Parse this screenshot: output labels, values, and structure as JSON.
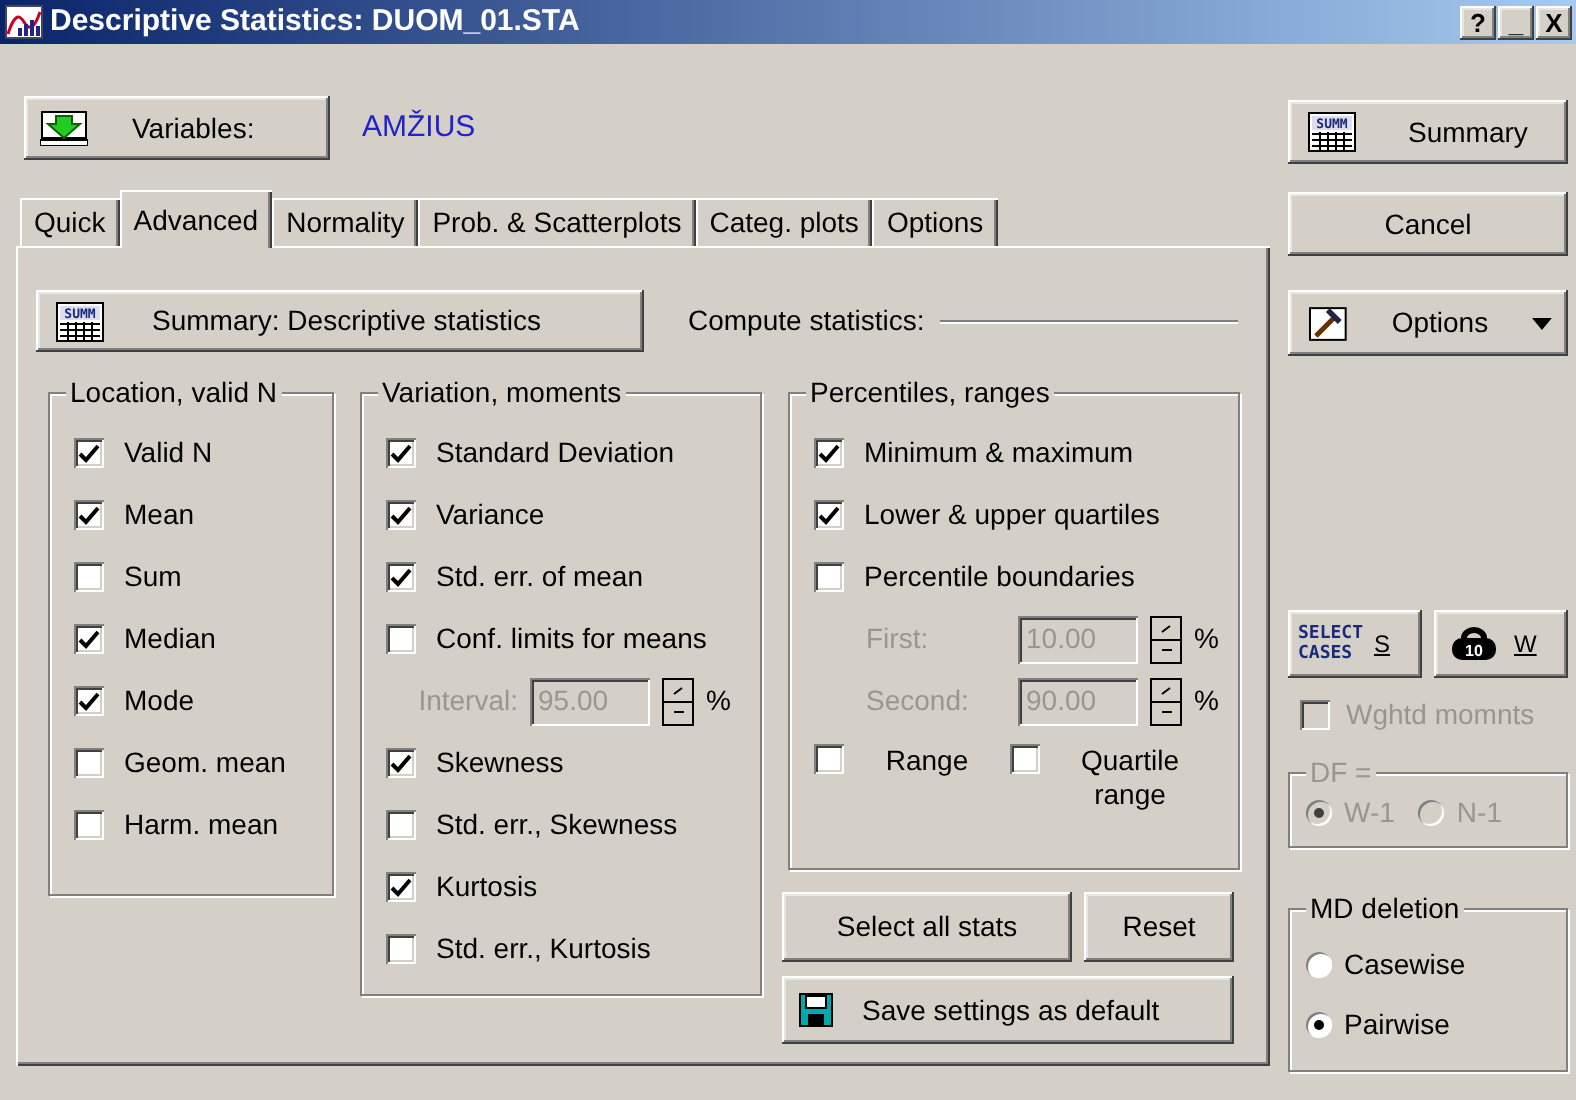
{
  "window": {
    "title": "Descriptive Statistics: DUOM_01.STA",
    "controls": [
      "?",
      "_",
      "X"
    ]
  },
  "variables": {
    "button": "Variables:",
    "value": "AMŽIUS"
  },
  "tabs": [
    {
      "label": "Quick",
      "selected": false
    },
    {
      "label": "Advanced",
      "selected": true
    },
    {
      "label": "Normality",
      "selected": false
    },
    {
      "label": "Prob. & Scatterplots",
      "selected": false
    },
    {
      "label": "Categ. plots",
      "selected": false
    },
    {
      "label": "Options",
      "selected": false
    }
  ],
  "summary_button": {
    "label": "Summary: Descriptive statistics",
    "icon_text": "SUMM"
  },
  "compute_label": "Compute statistics:",
  "groups": [
    {
      "title": "Location, valid N",
      "items": [
        {
          "kind": "checkbox",
          "label": "Valid N",
          "checked": true
        },
        {
          "kind": "checkbox",
          "label": "Mean",
          "checked": true
        },
        {
          "kind": "checkbox",
          "label": "Sum",
          "checked": false
        },
        {
          "kind": "checkbox",
          "label": "Median",
          "checked": true
        },
        {
          "kind": "checkbox",
          "label": "Mode",
          "checked": true
        },
        {
          "kind": "checkbox",
          "label": "Geom. mean",
          "checked": false
        },
        {
          "kind": "checkbox",
          "label": "Harm. mean",
          "checked": false
        }
      ]
    },
    {
      "title": "Variation, moments",
      "items": [
        {
          "kind": "checkbox",
          "label": "Standard Deviation",
          "checked": true
        },
        {
          "kind": "checkbox",
          "label": "Variance",
          "checked": true
        },
        {
          "kind": "checkbox",
          "label": "Std. err. of mean",
          "checked": true
        },
        {
          "kind": "checkbox",
          "label": "Conf. limits for means",
          "checked": false
        },
        {
          "kind": "spin",
          "label": "Interval:",
          "value": "95.00",
          "unit": "%",
          "disabled": true
        },
        {
          "kind": "checkbox",
          "label": "Skewness",
          "checked": true
        },
        {
          "kind": "checkbox",
          "label": "Std. err., Skewness",
          "checked": false
        },
        {
          "kind": "checkbox",
          "label": "Kurtosis",
          "checked": true
        },
        {
          "kind": "checkbox",
          "label": "Std. err., Kurtosis",
          "checked": false
        }
      ]
    },
    {
      "title": "Percentiles, ranges",
      "items": [
        {
          "kind": "checkbox",
          "label": "Minimum & maximum",
          "checked": true
        },
        {
          "kind": "checkbox",
          "label": "Lower & upper quartiles",
          "checked": true
        },
        {
          "kind": "checkbox",
          "label": "Percentile boundaries",
          "checked": false
        },
        {
          "kind": "spin",
          "label": "First:",
          "value": "10.00",
          "unit": "%",
          "disabled": true
        },
        {
          "kind": "spin",
          "label": "Second:",
          "value": "90.00",
          "unit": "%",
          "disabled": true
        },
        {
          "kind": "pair",
          "items": [
            {
              "label": "Range",
              "checked": false
            },
            {
              "label": "Quartile range",
              "checked": false
            }
          ]
        }
      ]
    }
  ],
  "panel_buttons": [
    "Select all stats",
    "Reset"
  ],
  "save_button": "Save settings as default",
  "side": {
    "summary": {
      "label": "Summary",
      "icon_text": "SUMM"
    },
    "cancel": "Cancel",
    "options": "Options",
    "select_cases": {
      "label": "SELECT CASES",
      "key": "S"
    },
    "weight": {
      "icon_text": "10",
      "key": "W"
    }
  },
  "weighted_moments": {
    "label": "Wghtd momnts",
    "checked": false,
    "disabled": true
  },
  "df": {
    "title": "DF =",
    "disabled": true,
    "options": [
      {
        "label": "W-1",
        "selected": true
      },
      {
        "label": "N-1",
        "selected": false
      }
    ]
  },
  "md_deletion": {
    "title": "MD deletion",
    "options": [
      {
        "label": "Casewise",
        "selected": false
      },
      {
        "label": "Pairwise",
        "selected": true
      }
    ]
  }
}
